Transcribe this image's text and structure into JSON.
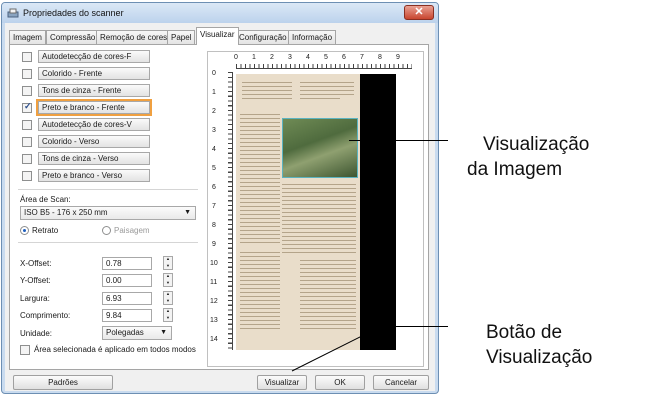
{
  "window": {
    "title": "Propriedades do scanner",
    "close_glyph": "✕"
  },
  "tabs": [
    {
      "label": "Imagem"
    },
    {
      "label": "Compressão"
    },
    {
      "label": "Remoção de cores"
    },
    {
      "label": "Papel"
    },
    {
      "label": "Visualizar"
    },
    {
      "label": "Configuração"
    },
    {
      "label": "Informação"
    }
  ],
  "image_types": [
    {
      "label": "Autodetecção de cores-F",
      "checked": false
    },
    {
      "label": "Colorido - Frente",
      "checked": false
    },
    {
      "label": "Tons de cinza - Frente",
      "checked": false
    },
    {
      "label": "Preto e branco - Frente",
      "checked": true,
      "selected": true
    },
    {
      "label": "Autodetecção de cores-V",
      "checked": false
    },
    {
      "label": "Colorido - Verso",
      "checked": false
    },
    {
      "label": "Tons de cinza - Verso",
      "checked": false
    },
    {
      "label": "Preto e branco - Verso",
      "checked": false
    }
  ],
  "scan_area": {
    "label": "Área de Scan:",
    "value": "ISO B5 - 176 x 250 mm",
    "portrait": "Retrato",
    "landscape": "Paisagem"
  },
  "fields": {
    "x_offset": {
      "label": "X-Offset:",
      "value": "0.78"
    },
    "y_offset": {
      "label": "Y-Offset:",
      "value": "0.00"
    },
    "width": {
      "label": "Largura:",
      "value": "6.93"
    },
    "length": {
      "label": "Comprimento:",
      "value": "9.84"
    },
    "unit": {
      "label": "Unidade:",
      "value": "Polegadas"
    }
  },
  "apply_all": "Área selecionada é aplicado em todos modos",
  "ruler": {
    "top": [
      "0",
      "1",
      "2",
      "3",
      "4",
      "5",
      "6",
      "7",
      "8",
      "9"
    ],
    "left": [
      "0",
      "1",
      "2",
      "3",
      "4",
      "5",
      "6",
      "7",
      "8",
      "9",
      "10",
      "11",
      "12",
      "13",
      "14"
    ]
  },
  "buttons": {
    "defaults": "Padrões",
    "preview": "Visualizar",
    "ok": "OK",
    "cancel": "Cancelar"
  },
  "callouts": {
    "image_preview_line1": "Visualização",
    "image_preview_line2": "da Imagem",
    "preview_button_line1": "Botão de",
    "preview_button_line2": "Visualização"
  }
}
